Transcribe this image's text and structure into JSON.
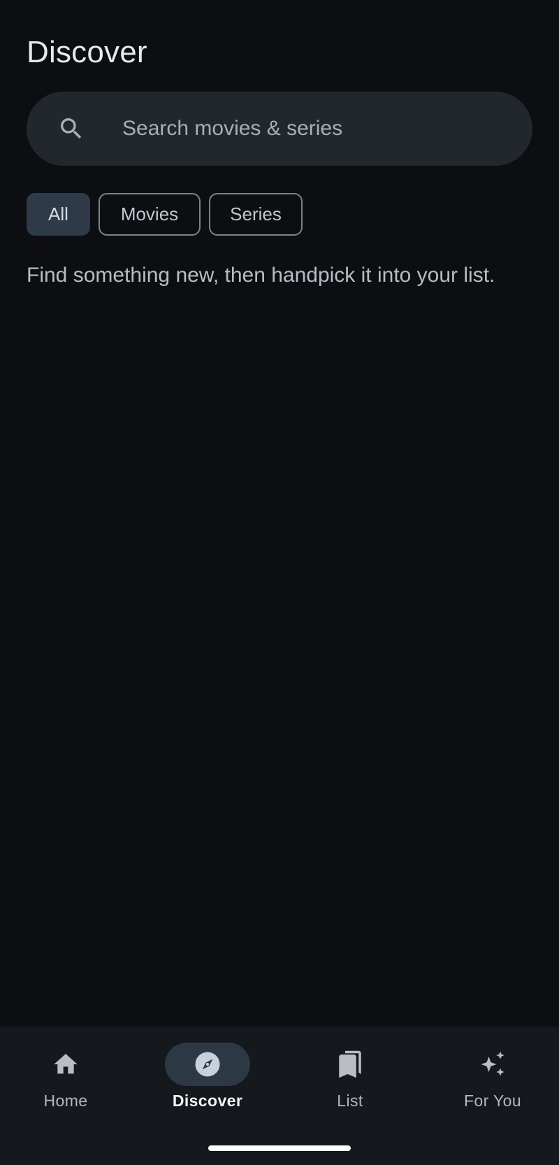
{
  "header": {
    "title": "Discover"
  },
  "search": {
    "placeholder": "Search movies & series",
    "value": ""
  },
  "filters": {
    "chips": [
      {
        "label": "All",
        "selected": true
      },
      {
        "label": "Movies",
        "selected": false
      },
      {
        "label": "Series",
        "selected": false
      }
    ]
  },
  "main": {
    "hint": "Find something new, then handpick it into your list."
  },
  "nav": {
    "items": [
      {
        "label": "Home",
        "icon": "home-icon",
        "active": false
      },
      {
        "label": "Discover",
        "icon": "compass-icon",
        "active": true
      },
      {
        "label": "List",
        "icon": "bookmarks-icon",
        "active": false
      },
      {
        "label": "For You",
        "icon": "sparkle-icon",
        "active": false
      }
    ]
  },
  "colors": {
    "background": "#0c0e12",
    "surface": "#22262d",
    "nav_background": "#15181d",
    "accent_container": "#2e3a48"
  }
}
